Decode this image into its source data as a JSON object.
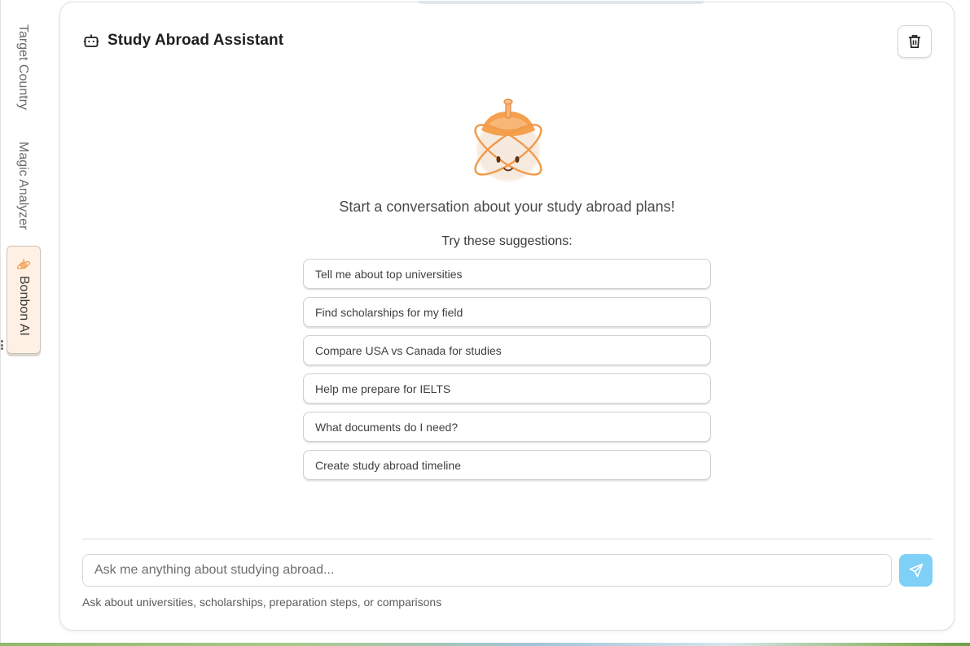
{
  "sidebar": {
    "tabs": [
      {
        "label": "Target Country",
        "active": false
      },
      {
        "label": "Magic Analyzer",
        "active": false
      },
      {
        "label": "Bonbon AI",
        "active": true,
        "icon": "bonbon-icon"
      }
    ]
  },
  "chat": {
    "title": "Study Abroad Assistant",
    "title_icon": "robot-icon",
    "clear_icon": "trash-icon",
    "welcome": "Start a conversation about your study abroad plans!",
    "suggestions_label": "Try these suggestions:",
    "suggestions": [
      "Tell me about top universities",
      "Find scholarships for my field",
      "Compare USA vs Canada for studies",
      "Help me prepare for IELTS",
      "What documents do I need?",
      "Create study abroad timeline"
    ],
    "input_placeholder": "Ask me anything about studying abroad...",
    "send_icon": "send-icon",
    "hint": "Ask about universities, scholarships, preparation steps, or comparisons"
  },
  "colors": {
    "accent_orange": "#f4a04f",
    "send_button": "#7fd0f7",
    "active_tab_bg": "#fff0e3"
  }
}
